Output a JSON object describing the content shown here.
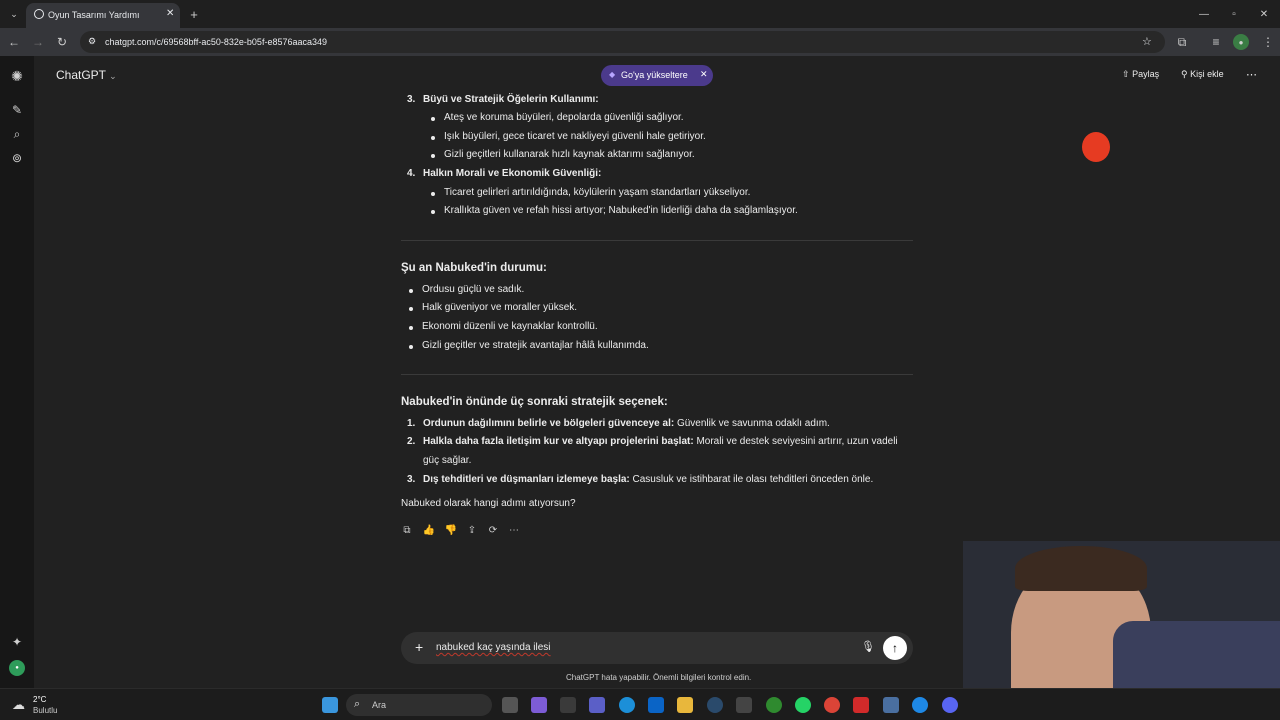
{
  "browser": {
    "tab_title": "Oyun Tasarımı Yardımı",
    "url": "chatgpt.com/c/69568bff-ac50-832e-b05f-e8576aaca349"
  },
  "header": {
    "app_name": "ChatGPT",
    "upgrade_label": "Go'ya yükseltere k",
    "share_label": "Paylaş",
    "add_person_label": "Kişi ekle"
  },
  "section1": {
    "item3_title": "Büyü ve Stratejik Öğelerin Kullanımı:",
    "item3_bullets": [
      "Ateş ve koruma büyüleri, depolarda güvenliği sağlıyor.",
      "Işık büyüleri, gece ticaret ve nakliyeyi güvenli hale getiriyor.",
      "Gizli geçitleri kullanarak hızlı kaynak aktarımı sağlanıyor."
    ],
    "item4_title": "Halkın Morali ve Ekonomik Güvenliği:",
    "item4_bullets": [
      "Ticaret gelirleri artırıldığında, köylülerin yaşam standartları yükseliyor.",
      "Krallıkta güven ve refah hissi artıyor; Nabuked'in liderliği daha da sağlamlaşıyor."
    ]
  },
  "section2": {
    "heading": "Şu an Nabuked'in durumu:",
    "bullets": [
      "Ordusu güçlü ve sadık.",
      "Halk güveniyor ve moraller yüksek.",
      "Ekonomi düzenli ve kaynaklar kontrollü.",
      "Gizli geçitler ve stratejik avantajlar hâlâ kullanımda."
    ]
  },
  "section3": {
    "heading": "Nabuked'in önünde üç sonraki stratejik seçenek:",
    "options": [
      {
        "bold": "Ordunun dağılımını belirle ve bölgeleri güvenceye al:",
        "text": " Güvenlik ve savunma odaklı adım."
      },
      {
        "bold": "Halkla daha fazla iletişim kur ve altyapı projelerini başlat:",
        "text": " Morali ve destek seviyesini artırır, uzun vadeli",
        "text2": "güç sağlar."
      },
      {
        "bold": "Dış tehditleri ve düşmanları izlemeye başla:",
        "text": " Casusluk ve istihbarat ile olası tehditleri önceden önle."
      }
    ],
    "question": "Nabuked olarak hangi adımı atıyorsun?"
  },
  "composer": {
    "input_value": "nabuked kaç yaşında ilesi",
    "disclaimer": "ChatGPT hata yapabilir. Önemli bilgileri kontrol edin."
  },
  "taskbar": {
    "weather_temp": "2°C",
    "weather_desc": "Bulutlu",
    "search_label": "Ara"
  },
  "colors": {
    "background": "#212121",
    "sidebar": "#171717",
    "upgrade_pill": "#4b3a8c",
    "accent_green": "#10a37f"
  }
}
